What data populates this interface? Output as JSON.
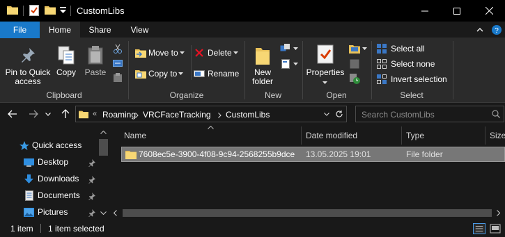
{
  "window": {
    "title": "CustomLibs",
    "colors": {
      "accent": "#1979ca",
      "background": "#191919",
      "ribbon": "#2b2b2b",
      "selection": "#777777"
    }
  },
  "tabs": [
    {
      "label": "File"
    },
    {
      "label": "Home"
    },
    {
      "label": "Share"
    },
    {
      "label": "View"
    }
  ],
  "ribbon": {
    "clipboard": {
      "pin_label_1": "Pin to Quick",
      "pin_label_2": "access",
      "copy": "Copy",
      "paste": "Paste",
      "group": "Clipboard"
    },
    "organize": {
      "move_to": "Move to",
      "copy_to": "Copy to",
      "delete": "Delete",
      "rename": "Rename",
      "group": "Organize"
    },
    "new": {
      "new_folder_1": "New",
      "new_folder_2": "folder",
      "group": "New"
    },
    "open": {
      "properties": "Properties",
      "group": "Open"
    },
    "select": {
      "select_all": "Select all",
      "select_none": "Select none",
      "invert": "Invert selection",
      "group": "Select"
    }
  },
  "address": {
    "overflow": "«",
    "crumbs": [
      "Roaming",
      "VRCFaceTracking",
      "CustomLibs"
    ],
    "search_placeholder": "Search CustomLibs"
  },
  "nav": {
    "items": [
      {
        "label": "Quick access",
        "icon": "star-icon"
      },
      {
        "label": "Desktop",
        "icon": "desktop-icon"
      },
      {
        "label": "Downloads",
        "icon": "download-icon"
      },
      {
        "label": "Documents",
        "icon": "document-icon"
      },
      {
        "label": "Pictures",
        "icon": "picture-icon"
      }
    ]
  },
  "columns": [
    "Name",
    "Date modified",
    "Type",
    "Size"
  ],
  "rows": [
    {
      "name": "7608ec5e-3900-4f08-9c94-2568255b9dce",
      "date": "13.05.2025 19:01",
      "type": "File folder",
      "size": ""
    }
  ],
  "status": {
    "count": "1 item",
    "selected": "1 item selected"
  }
}
